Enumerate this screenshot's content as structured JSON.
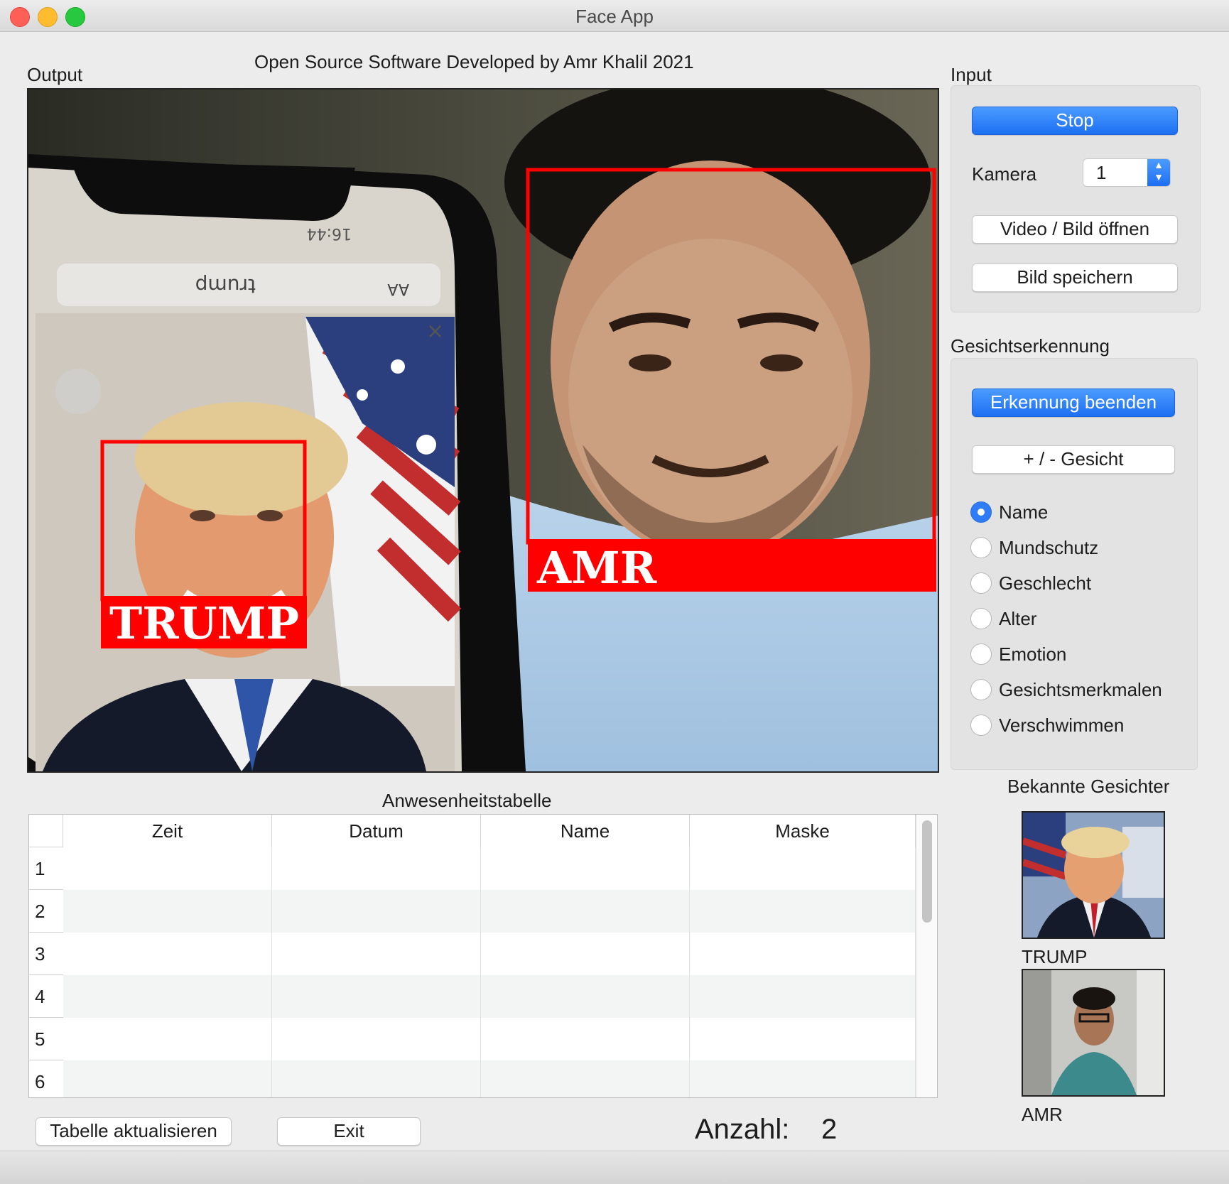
{
  "window": {
    "title": "Face App"
  },
  "header": {
    "output_label": "Output",
    "credit": "Open Source Software Developed by Amr Khalil 2021"
  },
  "video": {
    "phone_time": "16:44",
    "phone_url": "trump",
    "phone_aa": "AA",
    "faces": [
      {
        "name": "AMR"
      },
      {
        "name": "TRUMP"
      }
    ]
  },
  "input": {
    "title": "Input",
    "stop_label": "Stop",
    "camera_label": "Kamera",
    "camera_value": "1",
    "open_label": "Video / Bild  öffnen",
    "save_label": "Bild speichern"
  },
  "recognition": {
    "title": "Gesichtserkennung",
    "end_label": "Erkennung beenden",
    "face_label": "+ / - Gesicht",
    "options": [
      {
        "label": "Name",
        "selected": true
      },
      {
        "label": "Mundschutz",
        "selected": false
      },
      {
        "label": "Geschlecht",
        "selected": false
      },
      {
        "label": "Alter",
        "selected": false
      },
      {
        "label": "Emotion",
        "selected": false
      },
      {
        "label": "Gesichtsmerkmalen",
        "selected": false
      },
      {
        "label": "Verschwimmen",
        "selected": false
      }
    ]
  },
  "known": {
    "title": "Bekannte Gesichter",
    "faces": [
      {
        "name": "TRUMP"
      },
      {
        "name": "AMR"
      }
    ]
  },
  "attendance": {
    "title": "Anwesenheitstabelle",
    "columns": [
      "Zeit",
      "Datum",
      "Name",
      "Maske"
    ],
    "rows": [
      "1",
      "2",
      "3",
      "4",
      "5",
      "6"
    ]
  },
  "footer": {
    "refresh_label": "Tabelle aktualisieren",
    "exit_label": "Exit",
    "count_label": "Anzahl:",
    "count_value": "2"
  },
  "colors": {
    "accent": "#2f7cf6",
    "detection_box": "#ff0000"
  }
}
